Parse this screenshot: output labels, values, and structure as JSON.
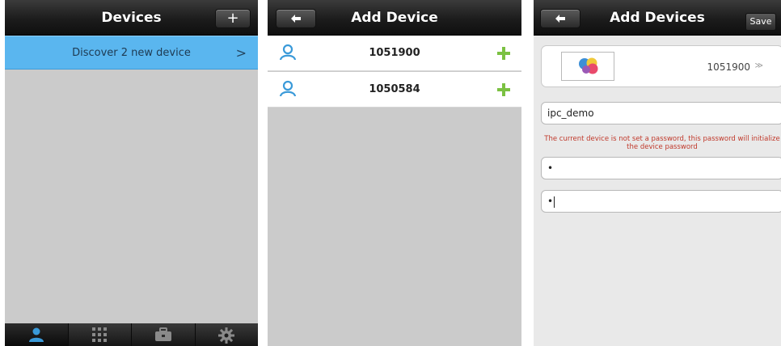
{
  "screen1": {
    "title": "Devices",
    "add_button": "+",
    "discover_text": "Discover  2  new device",
    "discover_chevron": ">",
    "tabs": [
      {
        "icon": "user-icon",
        "active": true
      },
      {
        "icon": "grid-icon",
        "active": false
      },
      {
        "icon": "toolbox-icon",
        "active": false
      },
      {
        "icon": "gear-icon",
        "active": false
      }
    ]
  },
  "screen2": {
    "title": "Add Device",
    "back_icon": "back-arrow-icon",
    "devices": [
      {
        "id": "1051900"
      },
      {
        "id": "1050584"
      }
    ]
  },
  "screen3": {
    "title": "Add Devices",
    "save_label": "Save",
    "device_id": "1051900",
    "chevron": "≫",
    "name_value": "ipc_demo",
    "notice": "The current device is not set a password, this password will initialize the device password",
    "password_value": "•",
    "confirm_value": "•"
  },
  "colors": {
    "accent": "#5ab6ef",
    "add_green": "#7bc142",
    "user_blue": "#3a9ad9",
    "notice_red": "#c0392b"
  }
}
